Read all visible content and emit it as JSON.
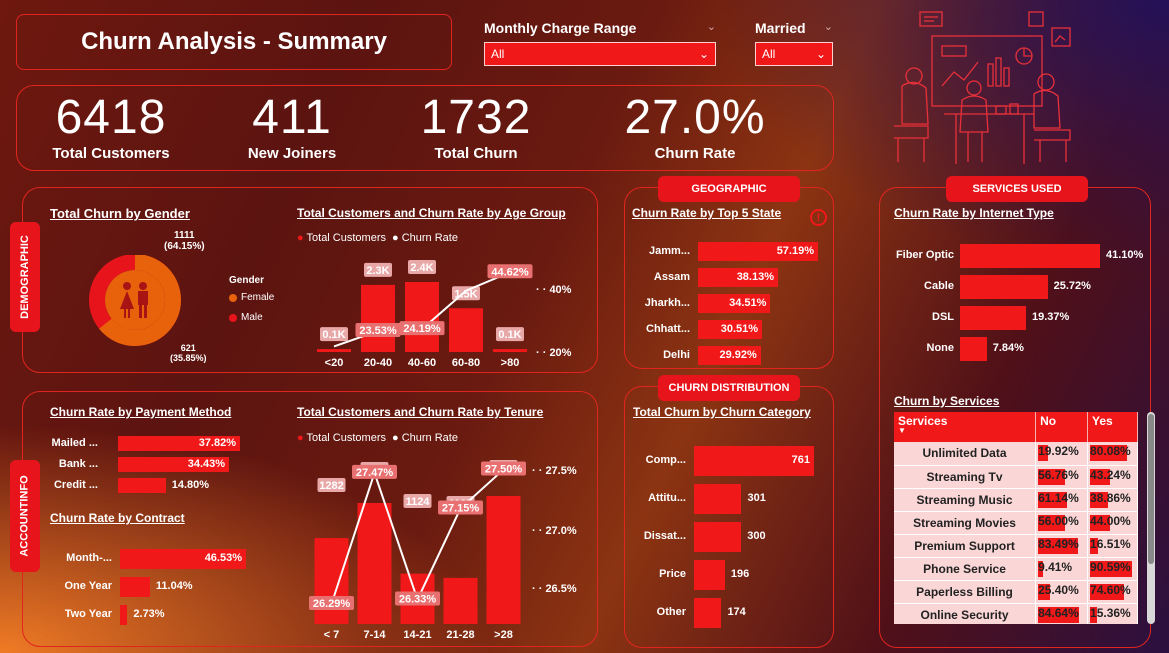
{
  "title": "Churn Analysis - Summary",
  "slicers": {
    "charge": {
      "label": "Monthly Charge Range",
      "value": "All"
    },
    "married": {
      "label": "Married",
      "value": "All"
    }
  },
  "kpis": [
    {
      "value": "6418",
      "label": "Total Customers"
    },
    {
      "value": "411",
      "label": "New Joiners"
    },
    {
      "value": "1732",
      "label": "Total Churn"
    },
    {
      "value": "27.0%",
      "label": "Churn  Rate"
    }
  ],
  "sections": {
    "demographic": "DEMOGRAPHIC",
    "account": "ACCOUNTINFO",
    "geographic": "GEOGRAPHIC",
    "churn_distribution": "CHURN DISTRIBUTION",
    "services_used": "SERVICES USED"
  },
  "gender": {
    "title": "Total Churn by Gender",
    "legend_title": "Gender",
    "female_label": "Female",
    "male_label": "Male",
    "female_value": "1111",
    "female_pct": "(64.15%)",
    "male_value": "621",
    "male_pct": "(35.85%)",
    "female_share": 0.6415,
    "colors": {
      "female": "#e8620c",
      "male": "#e8141c"
    }
  },
  "age": {
    "title": "Total Customers and Churn Rate by Age Group",
    "legend": {
      "bars": "Total Customers",
      "line": "Churn Rate"
    },
    "right_axis": [
      "40%",
      "20%"
    ]
  },
  "tenure": {
    "title": "Total Customers and Churn Rate by Tenure",
    "legend": {
      "bars": "Total Customers",
      "line": "Churn Rate"
    },
    "right_axis": [
      "27.5%",
      "27.0%",
      "26.5%"
    ]
  },
  "payment": {
    "title": "Churn Rate by Payment Method",
    "rows": [
      {
        "label": "Mailed ...",
        "value": "37.82%",
        "v": 37.82
      },
      {
        "label": "Bank ...",
        "value": "34.43%",
        "v": 34.43
      },
      {
        "label": "Credit ...",
        "value": "14.80%",
        "v": 14.8
      }
    ]
  },
  "contract": {
    "title": "Churn Rate by Contract",
    "rows": [
      {
        "label": "Month-...",
        "value": "46.53%",
        "v": 46.53
      },
      {
        "label": "One Year",
        "value": "11.04%",
        "v": 11.04
      },
      {
        "label": "Two Year",
        "value": "2.73%",
        "v": 2.73
      }
    ]
  },
  "state": {
    "title": "Churn Rate by Top 5 State",
    "rows": [
      {
        "label": "Jamm...",
        "value": "57.19%",
        "v": 57.19
      },
      {
        "label": "Assam",
        "value": "38.13%",
        "v": 38.13
      },
      {
        "label": "Jharkh...",
        "value": "34.51%",
        "v": 34.51
      },
      {
        "label": "Chhatt...",
        "value": "30.51%",
        "v": 30.51
      },
      {
        "label": "Delhi",
        "value": "29.92%",
        "v": 29.92
      }
    ]
  },
  "category": {
    "title": "Total Churn by Churn Category",
    "rows": [
      {
        "label": "Comp...",
        "value": "761",
        "v": 761
      },
      {
        "label": "Attitu...",
        "value": "301",
        "v": 301
      },
      {
        "label": "Dissat...",
        "value": "300",
        "v": 300
      },
      {
        "label": "Price",
        "value": "196",
        "v": 196
      },
      {
        "label": "Other",
        "value": "174",
        "v": 174
      }
    ]
  },
  "internet": {
    "title": "Churn Rate by Internet Type",
    "rows": [
      {
        "label": "Fiber Optic",
        "value": "41.10%",
        "v": 41.1
      },
      {
        "label": "Cable",
        "value": "25.72%",
        "v": 25.72
      },
      {
        "label": "DSL",
        "value": "19.37%",
        "v": 19.37
      },
      {
        "label": "None",
        "value": "7.84%",
        "v": 7.84
      }
    ]
  },
  "services": {
    "title": "Churn by Services",
    "columns": [
      "Services",
      "No",
      "Yes"
    ],
    "rows": [
      {
        "name": "Unlimited Data",
        "no": "19.92%",
        "yes": "80.08%",
        "no_v": 19.92,
        "yes_v": 80.08
      },
      {
        "name": "Streaming Tv",
        "no": "56.76%",
        "yes": "43.24%",
        "no_v": 56.76,
        "yes_v": 43.24
      },
      {
        "name": "Streaming Music",
        "no": "61.14%",
        "yes": "38.86%",
        "no_v": 61.14,
        "yes_v": 38.86
      },
      {
        "name": "Streaming Movies",
        "no": "56.00%",
        "yes": "44.00%",
        "no_v": 56.0,
        "yes_v": 44.0
      },
      {
        "name": "Premium Support",
        "no": "83.49%",
        "yes": "16.51%",
        "no_v": 83.49,
        "yes_v": 16.51
      },
      {
        "name": "Phone Service",
        "no": "9.41%",
        "yes": "90.59%",
        "no_v": 9.41,
        "yes_v": 90.59
      },
      {
        "name": "Paperless Billing",
        "no": "25.40%",
        "yes": "74.60%",
        "no_v": 25.4,
        "yes_v": 74.6
      },
      {
        "name": "Online Security",
        "no": "84.64%",
        "yes": "15.36%",
        "no_v": 84.64,
        "yes_v": 15.36
      }
    ]
  },
  "chart_data": [
    {
      "type": "pie",
      "title": "Total Churn by Gender",
      "categories": [
        "Female",
        "Male"
      ],
      "values": [
        1111,
        621
      ]
    },
    {
      "type": "bar",
      "title": "Total Customers and Churn Rate by Age Group",
      "categories": [
        "<20",
        "20-40",
        "40-60",
        "60-80",
        ">80"
      ],
      "series": [
        {
          "name": "Total Customers",
          "values": [
            100,
            2300,
            2400,
            1500,
            100
          ],
          "labels": [
            "0.1K",
            "2.3K",
            "2.4K",
            "1.5K",
            "0.1K"
          ]
        },
        {
          "name": "Churn Rate",
          "values": [
            18.0,
            23.53,
            24.19,
            38.0,
            44.62
          ],
          "labels": [
            "",
            "23.53%",
            "24.19%",
            "",
            "44.62%"
          ]
        }
      ]
    },
    {
      "type": "bar",
      "title": "Total Customers and Churn Rate by Tenure",
      "categories": [
        "< 7",
        "7-14",
        "14-21",
        "21-28",
        ">28"
      ],
      "series": [
        {
          "name": "Total Customers",
          "values": [
            1282,
            1438,
            1124,
            1105,
            1469
          ]
        },
        {
          "name": "Churn Rate",
          "values": [
            26.29,
            27.47,
            26.33,
            27.15,
            27.5
          ],
          "labels": [
            "26.29%",
            "27.47%",
            "26.33%",
            "27.15%",
            "27.50%"
          ]
        }
      ]
    },
    {
      "type": "bar",
      "title": "Churn Rate by Payment Method",
      "categories": [
        "Mailed ...",
        "Bank ...",
        "Credit ..."
      ],
      "values": [
        37.82,
        34.43,
        14.8
      ]
    },
    {
      "type": "bar",
      "title": "Churn Rate by Contract",
      "categories": [
        "Month-...",
        "One Year",
        "Two Year"
      ],
      "values": [
        46.53,
        11.04,
        2.73
      ]
    },
    {
      "type": "bar",
      "title": "Churn Rate by Top 5 State",
      "categories": [
        "Jamm...",
        "Assam",
        "Jharkh...",
        "Chhatt...",
        "Delhi"
      ],
      "values": [
        57.19,
        38.13,
        34.51,
        30.51,
        29.92
      ]
    },
    {
      "type": "bar",
      "title": "Total Churn by Churn Category",
      "categories": [
        "Comp...",
        "Attitu...",
        "Dissat...",
        "Price",
        "Other"
      ],
      "values": [
        761,
        301,
        300,
        196,
        174
      ]
    },
    {
      "type": "bar",
      "title": "Churn Rate by Internet Type",
      "categories": [
        "Fiber Optic",
        "Cable",
        "DSL",
        "None"
      ],
      "values": [
        41.1,
        25.72,
        19.37,
        7.84
      ]
    }
  ]
}
